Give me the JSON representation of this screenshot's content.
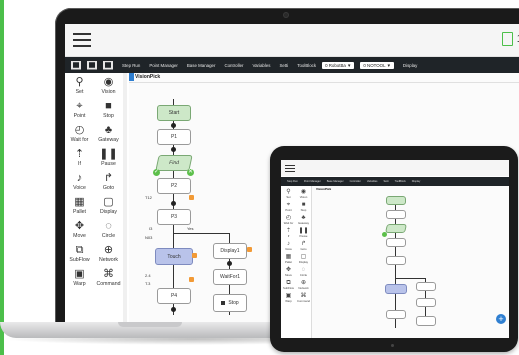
{
  "laptop": {
    "topbar": {
      "doc_icon": "document-icon",
      "counter": "10"
    },
    "toolbar": {
      "menu": [
        "Step Run",
        "Point Manager",
        "Base Manager",
        "Controller",
        "Variables",
        "Setti",
        "ToolBlock"
      ],
      "select1": "0 RobotBa ▼",
      "select2": "0 NOTOOL ▼",
      "display": "Display"
    },
    "sidebar": [
      {
        "label": "Set",
        "icon": "set-icon"
      },
      {
        "label": "Vision",
        "icon": "vision-icon"
      },
      {
        "label": "Point",
        "icon": "point-icon"
      },
      {
        "label": "Stop",
        "icon": "stop-icon"
      },
      {
        "label": "Wait for",
        "icon": "wait-icon"
      },
      {
        "label": "Gateway",
        "icon": "gateway-icon"
      },
      {
        "label": "If",
        "icon": "if-icon"
      },
      {
        "label": "Pause",
        "icon": "pause-icon"
      },
      {
        "label": "Voice",
        "icon": "voice-icon"
      },
      {
        "label": "Goto",
        "icon": "goto-icon"
      },
      {
        "label": "Pallet",
        "icon": "pallet-icon"
      },
      {
        "label": "Display",
        "icon": "display-icon"
      },
      {
        "label": "Move",
        "icon": "move-icon"
      },
      {
        "label": "Circle",
        "icon": "circle-icon"
      },
      {
        "label": "SubFlow",
        "icon": "subflow-icon"
      },
      {
        "label": "Network",
        "icon": "network-icon"
      },
      {
        "label": "Warp",
        "icon": "warp-icon"
      },
      {
        "label": "Command",
        "icon": "command-icon"
      }
    ],
    "canvas": {
      "tab": "VisionPick",
      "nodes": {
        "start": "Start",
        "p1": "P1",
        "find": "Find",
        "p2": "P2",
        "p3": "P3",
        "touch": "Touch",
        "p4": "P4",
        "display": "Display1",
        "wait": "WaitFor1",
        "stop": "Stop"
      },
      "labels": {
        "t12": "T12",
        "q12": "[Q2]",
        "id3": "I3",
        "yes": "Yes",
        "n03": "N03",
        "t24": "2.4",
        "t13": "T.3"
      }
    }
  },
  "tablet": {
    "toolbar": [
      "Step Run",
      "Point Manager",
      "Base Manager",
      "Controller",
      "Variables",
      "Setti",
      "ToolBlock",
      "Display"
    ],
    "tab": "VisionPick",
    "sidebar": [
      "Set",
      "Vision",
      "Point",
      "Stop",
      "Wait for",
      "Gateway",
      "If",
      "Pause",
      "Voice",
      "Goto",
      "Pallet",
      "Display",
      "Move",
      "Circle",
      "SubFlow",
      "Network",
      "Warp",
      "Command"
    ],
    "add_button": "+"
  },
  "colors": {
    "accent": "#4cbf4a",
    "toolbar_bg": "#1f2428",
    "node_green": "#cde8c8",
    "node_blue": "#b9c3ea",
    "output_orange": "#f29a36",
    "add_blue": "#2f7fd1"
  }
}
